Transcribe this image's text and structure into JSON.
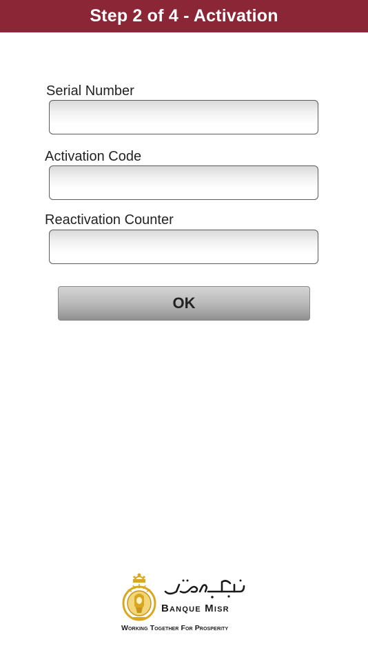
{
  "header": {
    "title": "Step 2 of 4 - Activation",
    "background_color": "#8b2636"
  },
  "form": {
    "serial_number": {
      "label": "Serial Number",
      "value": "",
      "placeholder": ""
    },
    "activation_code": {
      "label": "Activation Code",
      "value": "",
      "placeholder": ""
    },
    "reactivation_counter": {
      "label": "Reactivation Counter",
      "value": "",
      "placeholder": ""
    },
    "ok_button_label": "OK"
  },
  "branding": {
    "emblem_icon": "banque-misr-emblem-icon",
    "arabic_name": "بنك مصر",
    "name": "Banque Misr",
    "tagline": "Working Together For Prosperity",
    "gold_color": "#d9a820"
  }
}
